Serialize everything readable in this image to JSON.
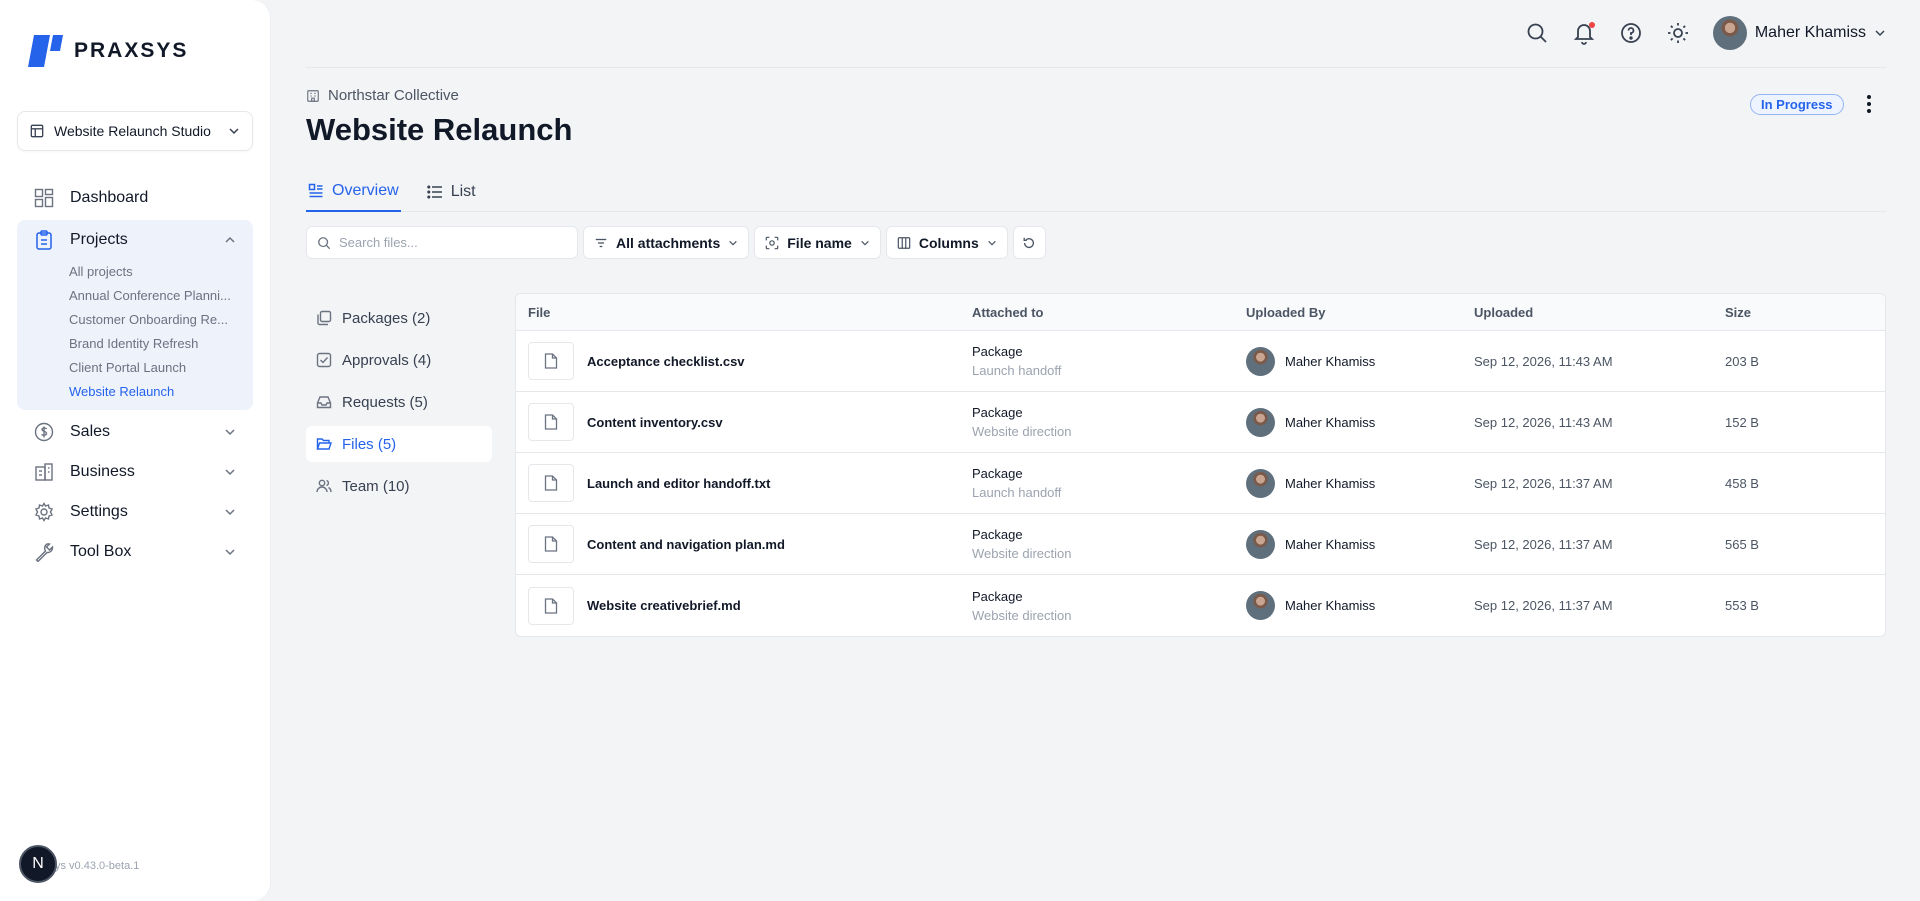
{
  "app": {
    "brand": "PRAXSYS",
    "version": "ys v0.43.0-beta.1",
    "badge": "N"
  },
  "workspace": {
    "label": "Website Relaunch Studio"
  },
  "nav": {
    "dashboard": "Dashboard",
    "projects": "Projects",
    "project_items": [
      "All projects",
      "Annual Conference Planni...",
      "Customer Onboarding Re...",
      "Brand Identity Refresh",
      "Client Portal Launch",
      "Website Relaunch"
    ],
    "sales": "Sales",
    "business": "Business",
    "settings": "Settings",
    "toolbox": "Tool Box"
  },
  "topbar": {
    "user_name": "Maher Khamiss"
  },
  "header": {
    "org": "Northstar Collective",
    "title": "Website Relaunch",
    "status": "In Progress"
  },
  "tabs": {
    "overview": "Overview",
    "list": "List"
  },
  "filters": {
    "search_placeholder": "Search files...",
    "attachments": "All attachments",
    "filename": "File name",
    "columns": "Columns"
  },
  "subnav": {
    "packages": "Packages (2)",
    "approvals": "Approvals (4)",
    "requests": "Requests (5)",
    "files": "Files (5)",
    "team": "Team (10)"
  },
  "table": {
    "headers": {
      "file": "File",
      "attached": "Attached to",
      "uploaded_by": "Uploaded By",
      "uploaded": "Uploaded",
      "size": "Size"
    },
    "rows": [
      {
        "name": "Acceptance checklist.csv",
        "att_type": "Package",
        "att_sub": "Launch handoff",
        "by": "Maher Khamiss",
        "date": "Sep 12, 2026, 11:43 AM",
        "size": "203 B"
      },
      {
        "name": "Content inventory.csv",
        "att_type": "Package",
        "att_sub": "Website direction",
        "by": "Maher Khamiss",
        "date": "Sep 12, 2026, 11:43 AM",
        "size": "152 B"
      },
      {
        "name": "Launch and editor handoff.txt",
        "att_type": "Package",
        "att_sub": "Launch handoff",
        "by": "Maher Khamiss",
        "date": "Sep 12, 2026, 11:37 AM",
        "size": "458 B"
      },
      {
        "name": "Content and navigation plan.md",
        "att_type": "Package",
        "att_sub": "Website direction",
        "by": "Maher Khamiss",
        "date": "Sep 12, 2026, 11:37 AM",
        "size": "565 B"
      },
      {
        "name": "Website creativebrief.md",
        "att_type": "Package",
        "att_sub": "Website direction",
        "by": "Maher Khamiss",
        "date": "Sep 12, 2026, 11:37 AM",
        "size": "553 B"
      }
    ]
  },
  "colors": {
    "accent": "#2563eb",
    "brand": "#2563eb",
    "notification": "#ef4444"
  }
}
